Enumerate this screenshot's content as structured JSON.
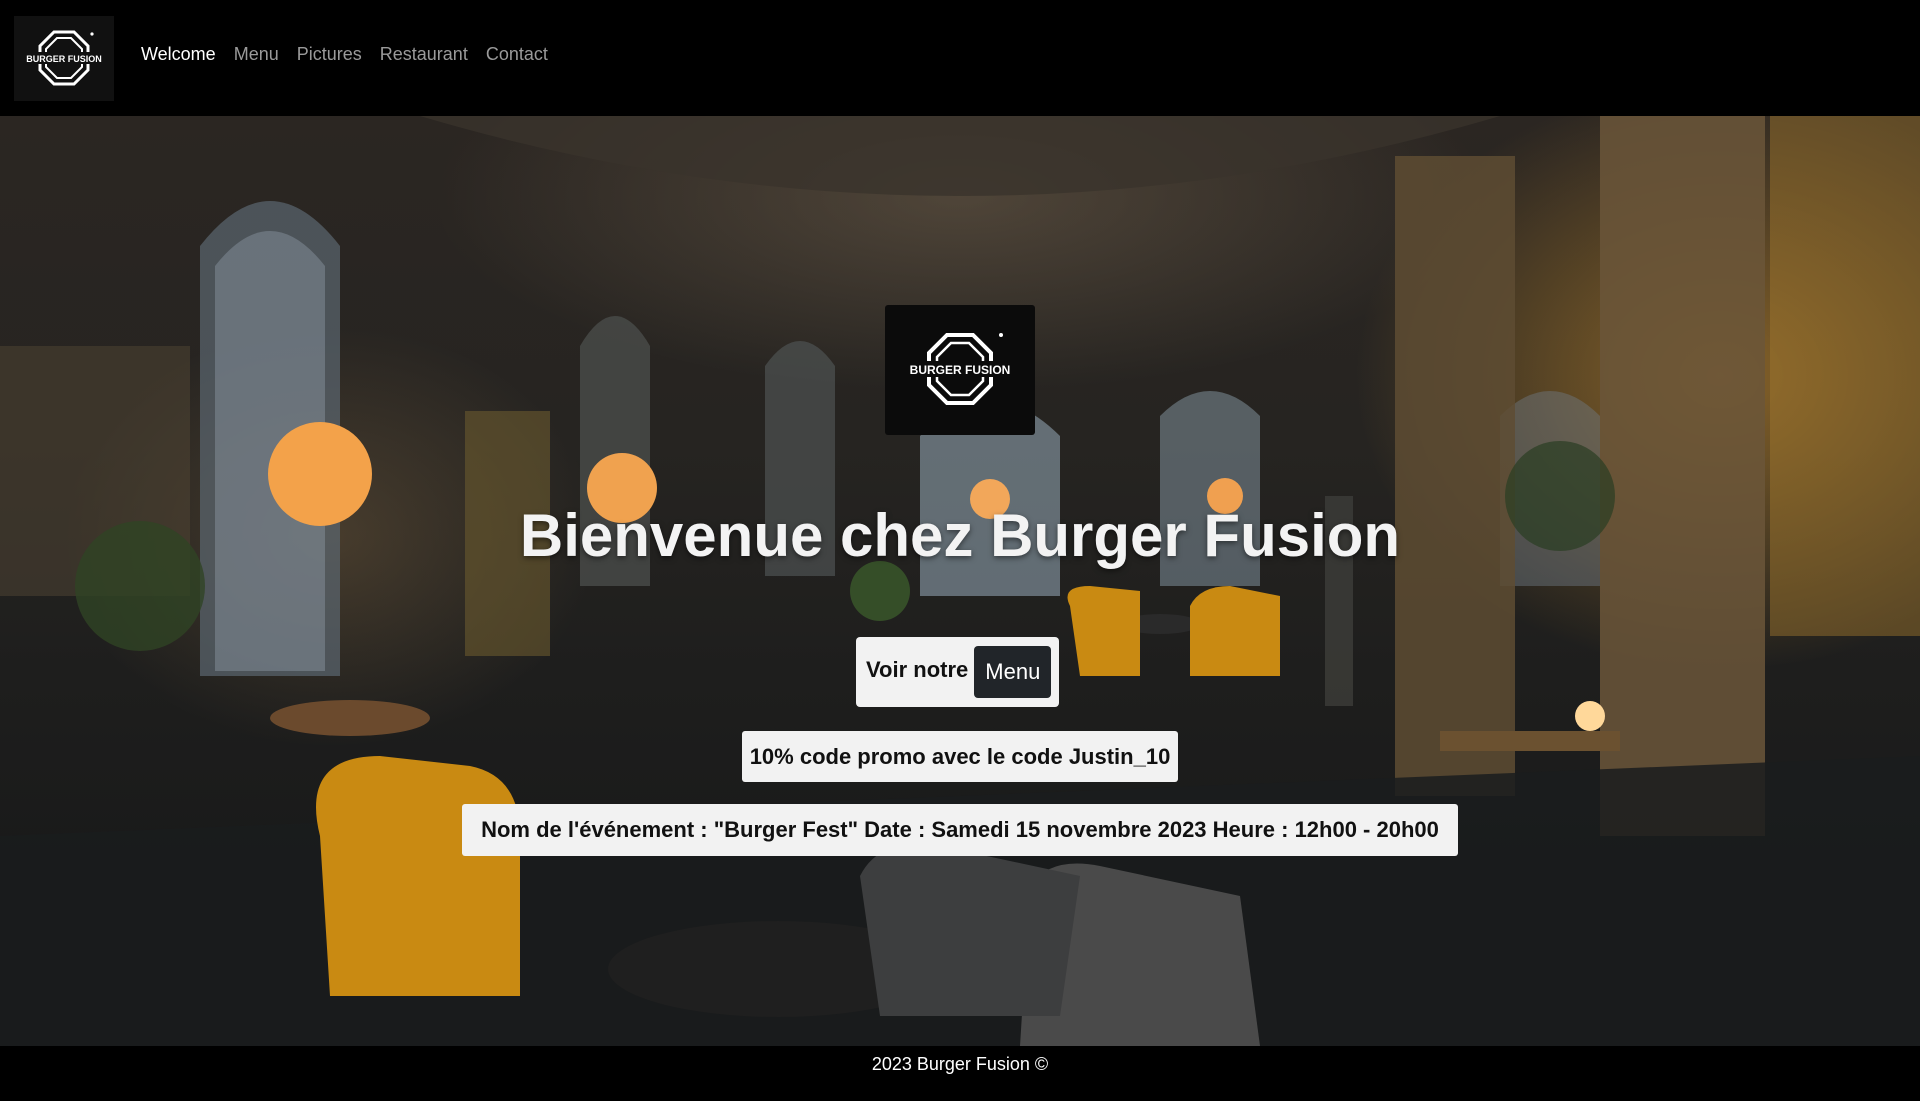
{
  "brand": {
    "logo_text": "BURGER FUSION",
    "logo_icon": "burger-fusion-logo"
  },
  "nav": {
    "items": [
      {
        "label": "Welcome",
        "active": true
      },
      {
        "label": "Menu",
        "active": false
      },
      {
        "label": "Pictures",
        "active": false
      },
      {
        "label": "Restaurant",
        "active": false
      },
      {
        "label": "Contact",
        "active": false
      }
    ]
  },
  "hero": {
    "title": "Bienvenue chez Burger Fusion",
    "cta_text": "Voir notre",
    "cta_button": "Menu",
    "promo": "10% code promo avec le code Justin_10",
    "event": "Nom de l'événement : \"Burger Fest\" Date : Samedi 15 novembre 2023 Heure : 12h00 - 20h00"
  },
  "footer": {
    "copyright": "2023 Burger Fusion ©"
  },
  "colors": {
    "nav_bg": "#000000",
    "nav_active": "#ffffff",
    "nav_inactive": "#9a9a9a",
    "button_dark": "#212529",
    "panel_bg": "#f2f2f2",
    "accent_mustard": "#c98a12",
    "lamp_orange": "#f3a24a"
  }
}
